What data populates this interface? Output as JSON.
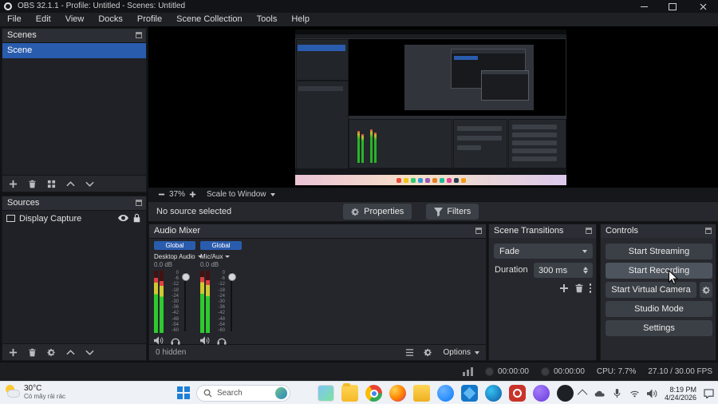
{
  "window": {
    "title": "OBS 32.1.1 - Profile: Untitled - Scenes: Untitled"
  },
  "menu": {
    "items": [
      "File",
      "Edit",
      "View",
      "Docks",
      "Profile",
      "Scene Collection",
      "Tools",
      "Help"
    ]
  },
  "scenes": {
    "title": "Scenes",
    "items": [
      {
        "name": "Scene",
        "selected": true
      }
    ]
  },
  "sources": {
    "title": "Sources",
    "items": [
      {
        "name": "Display Capture"
      }
    ]
  },
  "preview_bar": {
    "zoom": "37%",
    "scale_mode": "Scale to Window"
  },
  "source_bar": {
    "status": "No source selected",
    "properties": "Properties",
    "filters": "Filters"
  },
  "audio_mixer": {
    "title": "Audio Mixer",
    "channels": [
      {
        "badge": "Global",
        "name": "Desktop Audio",
        "level": "0.0 dB"
      },
      {
        "badge": "Global",
        "name": "Mic/Aux",
        "level": "0.0 dB"
      }
    ],
    "ticks": [
      "0",
      "-6",
      "-12",
      "-18",
      "-24",
      "-30",
      "-36",
      "-42",
      "-48",
      "-54",
      "-60"
    ],
    "hidden_label": "0 hidden",
    "options_label": "Options"
  },
  "transitions": {
    "title": "Scene Transitions",
    "current": "Fade",
    "duration_label": "Duration",
    "duration_value": "300 ms"
  },
  "controls": {
    "title": "Controls",
    "buttons": [
      "Start Streaming",
      "Start Recording",
      "Start Virtual Camera",
      "Studio Mode",
      "Settings"
    ]
  },
  "status_bar": {
    "rec_time": "00:00:00",
    "stream_time": "00:00:00",
    "cpu": "CPU: 7.7%",
    "fps": "27.10 / 30.00 FPS"
  },
  "taskbar": {
    "weather_temp": "30°C",
    "weather_desc": "Có mây rải rác",
    "search_label": "Search",
    "apps": [
      "photos",
      "explorer",
      "chrome",
      "firefox",
      "folder",
      "messenger",
      "vscode",
      "edge",
      "obs",
      "discord",
      "github"
    ],
    "time": "8:19 PM",
    "date": "4/24/2026"
  },
  "colors": {
    "accent": "#2a5cae",
    "button": "#3b4046",
    "button_hover": "#4d545d",
    "meter_green": "#2fca2f"
  }
}
